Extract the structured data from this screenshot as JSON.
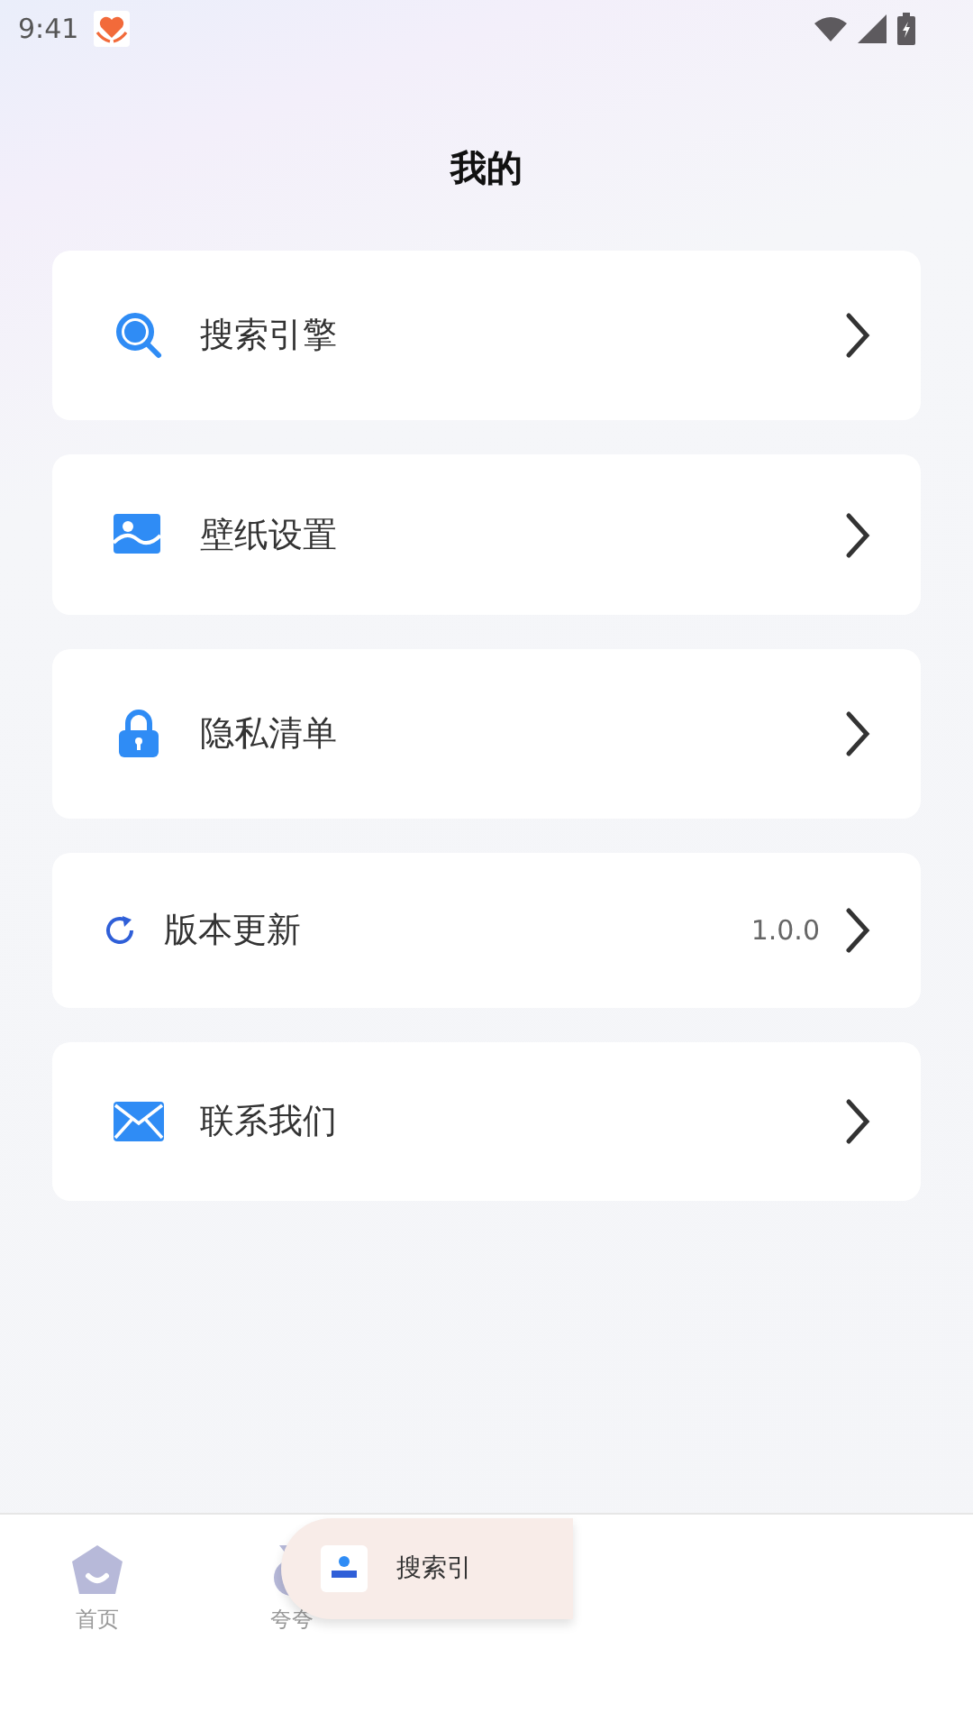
{
  "status_bar": {
    "time": "9:41"
  },
  "title": "我的",
  "menu": [
    {
      "label": "搜索引擎"
    },
    {
      "label": "壁纸设置"
    },
    {
      "label": "隐私清单"
    },
    {
      "label": "版本更新",
      "value": "1.0.0"
    },
    {
      "label": "联系我们"
    }
  ],
  "tab_bar": [
    {
      "label": "首页"
    },
    {
      "label": "夸夸"
    }
  ],
  "toast": {
    "text": "搜索引"
  }
}
